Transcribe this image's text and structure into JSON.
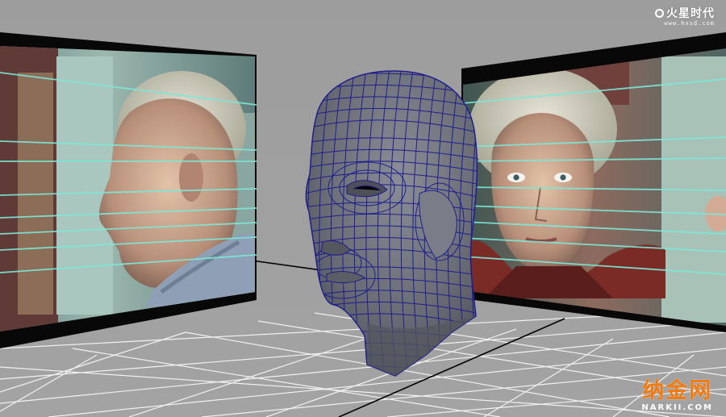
{
  "watermarks": {
    "top_logo": "火星时代",
    "top_url": "www.hxsd.com",
    "bottom_logo_cn": "纳金网",
    "bottom_logo_en": "NARKII.COM"
  },
  "colors": {
    "background": "#9c9c9c",
    "grid_line": "#ffffff",
    "wire": "#1e1e8c",
    "mesh_fill": "#6d6f78",
    "guide_lines": "#7de8d8",
    "accent_orange": "#f07a10"
  },
  "icons": {
    "top_logo_icon": "ring-logo-icon"
  }
}
